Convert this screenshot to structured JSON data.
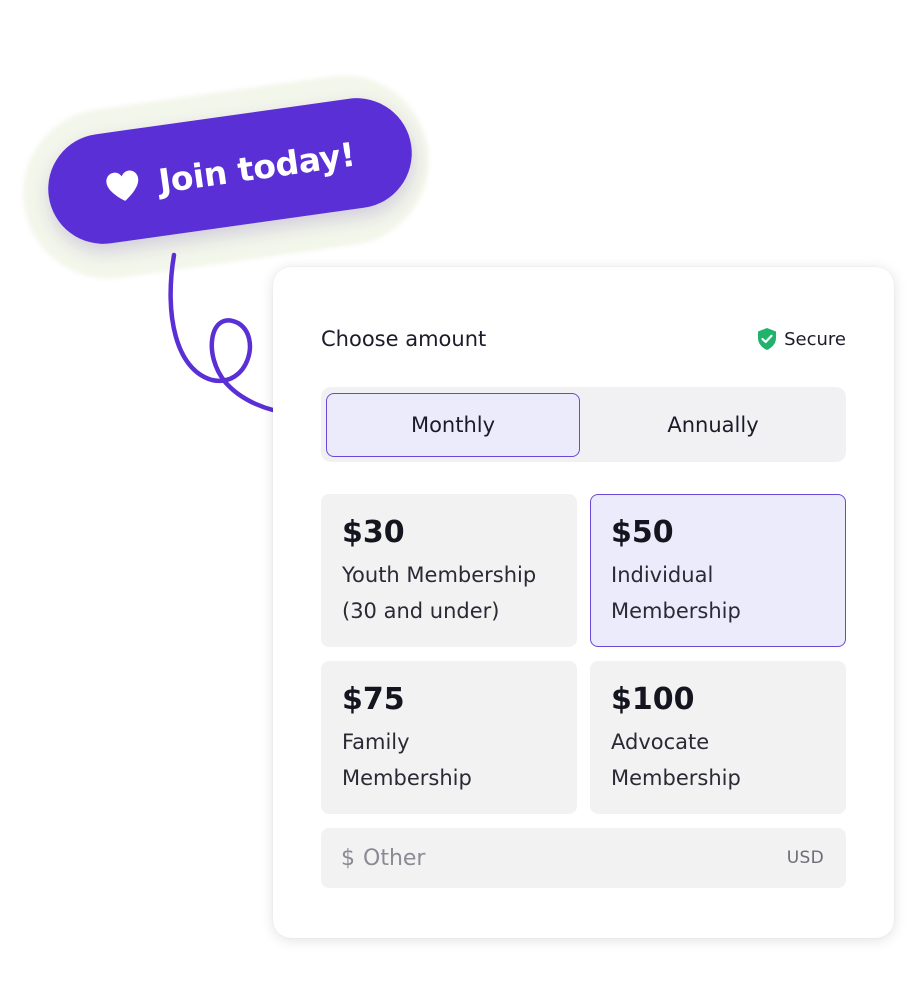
{
  "join": {
    "label": "Join today!",
    "icon": "heart-icon",
    "background": "#5a2fd6"
  },
  "card": {
    "title": "Choose amount",
    "secure": {
      "label": "Secure",
      "icon": "shield-check-icon",
      "color": "#21b36b"
    }
  },
  "frequency": {
    "options": [
      {
        "label": "Monthly",
        "selected": true
      },
      {
        "label": "Annually",
        "selected": false
      }
    ]
  },
  "amounts": [
    {
      "price": "$30",
      "desc_line1": "Youth Membership",
      "desc_line2": "(30 and under)",
      "selected": false
    },
    {
      "price": "$50",
      "desc_line1": "Individual",
      "desc_line2": "Membership",
      "selected": true
    },
    {
      "price": "$75",
      "desc_line1": "Family",
      "desc_line2": "Membership",
      "selected": false
    },
    {
      "price": "$100",
      "desc_line1": "Advocate",
      "desc_line2": "Membership",
      "selected": false
    }
  ],
  "other": {
    "symbol": "$",
    "placeholder": "Other",
    "currency": "USD"
  },
  "colors": {
    "accent": "#5a2fd6",
    "selected_bg": "#ecebfc",
    "tile_bg": "#f2f2f3"
  }
}
